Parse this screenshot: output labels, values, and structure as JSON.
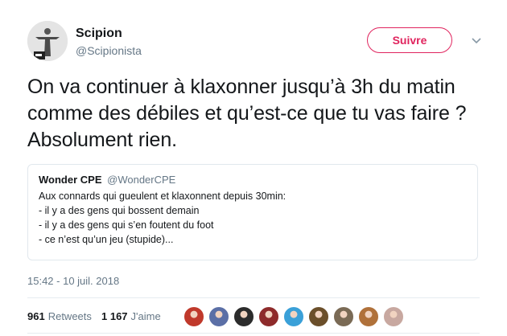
{
  "user": {
    "display_name": "Scipion",
    "handle": "@Scipionista",
    "follow_label": "Suivre"
  },
  "tweet": {
    "text": "On va continuer à klaxonner jusqu’à 3h du matin comme des débiles et qu’est-ce que tu vas faire ? Absolument rien.",
    "timestamp": "15:42 - 10 juil. 2018"
  },
  "quote": {
    "name": "Wonder CPE",
    "handle": "@WonderCPE",
    "lines": [
      "Aux connards qui gueulent et klaxonnent depuis 30min:",
      "- il y a des gens qui bossent demain",
      "- il y a des gens qui s’en foutent du foot",
      "- ce n’est qu’un jeu (stupide)..."
    ]
  },
  "stats": {
    "retweets_count": "961",
    "retweets_label": "Retweets",
    "likes_count": "1 167",
    "likes_label": "J'aime"
  },
  "likers": [
    {
      "name": "liker-avatar-1",
      "color": "#c0392b"
    },
    {
      "name": "liker-avatar-2",
      "color": "#5b6fa6"
    },
    {
      "name": "liker-avatar-3",
      "color": "#2c2c2c"
    },
    {
      "name": "liker-avatar-4",
      "color": "#8e2b2b"
    },
    {
      "name": "liker-avatar-5",
      "color": "#3aa0d8"
    },
    {
      "name": "liker-avatar-6",
      "color": "#6b4f2a"
    },
    {
      "name": "liker-avatar-7",
      "color": "#7a6a55"
    },
    {
      "name": "liker-avatar-8",
      "color": "#b0713a"
    },
    {
      "name": "liker-avatar-9",
      "color": "#c8a8a0"
    }
  ],
  "colors": {
    "accent": "#e0245e",
    "secondary_text": "#657786",
    "border": "#e1e8ed"
  }
}
